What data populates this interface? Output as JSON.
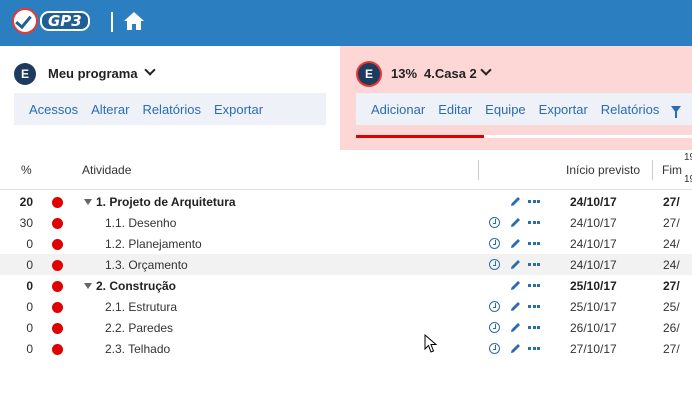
{
  "header": {
    "logo_text": "GP3",
    "home_icon": "home-icon",
    "brand_color": "#2b7fc0"
  },
  "left_panel": {
    "badge": "E",
    "title": "Meu programa",
    "menu": [
      "Acessos",
      "Alterar",
      "Relatórios",
      "Exportar"
    ]
  },
  "right_panel": {
    "badge": "E",
    "progress_label": "13%",
    "title": "4.Casa 2",
    "progress_value": 0.13,
    "menu": [
      "Adicionar",
      "Editar",
      "Equipe",
      "Exportar",
      "Relatórios"
    ],
    "filter_icon": "filter-icon",
    "background": "#fdd6d6"
  },
  "table": {
    "headers": {
      "pct": "%",
      "activity": "Atividade",
      "start": "Início previsto",
      "end": "Fim"
    },
    "edge_numbers": [
      "19",
      "19"
    ],
    "rows": [
      {
        "pct": "20",
        "name": "1. Projeto de Arquitetura",
        "start": "24/10/17",
        "end": "27/",
        "bold": true,
        "group": true,
        "clock": false
      },
      {
        "pct": "30",
        "name": "1.1. Desenho",
        "start": "24/10/17",
        "end": "27/",
        "bold": false,
        "group": false,
        "clock": true
      },
      {
        "pct": "0",
        "name": "1.2. Planejamento",
        "start": "24/10/17",
        "end": "24/",
        "bold": false,
        "group": false,
        "clock": true
      },
      {
        "pct": "0",
        "name": "1.3. Orçamento",
        "start": "24/10/17",
        "end": "24/",
        "bold": false,
        "group": false,
        "clock": true
      },
      {
        "pct": "0",
        "name": "2. Construção",
        "start": "25/10/17",
        "end": "27/",
        "bold": true,
        "group": true,
        "clock": false
      },
      {
        "pct": "0",
        "name": "2.1. Estrutura",
        "start": "25/10/17",
        "end": "25/",
        "bold": false,
        "group": false,
        "clock": true
      },
      {
        "pct": "0",
        "name": "2.2. Paredes",
        "start": "26/10/17",
        "end": "26/",
        "bold": false,
        "group": false,
        "clock": true
      },
      {
        "pct": "0",
        "name": "2.3. Telhado",
        "start": "27/10/17",
        "end": "27/",
        "bold": false,
        "group": false,
        "clock": true
      }
    ],
    "status_color": "#e00000"
  }
}
